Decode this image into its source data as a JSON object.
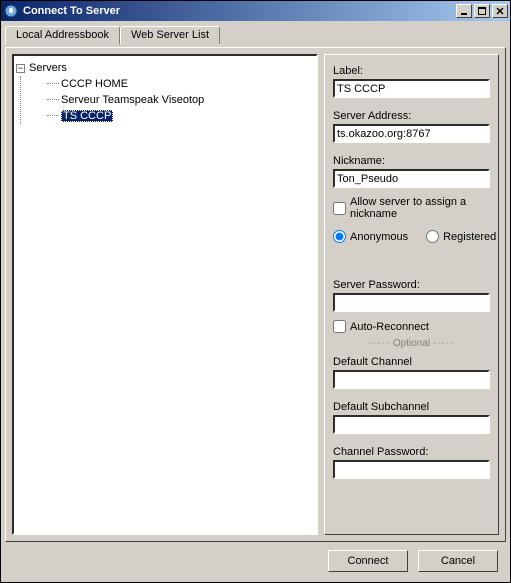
{
  "window": {
    "title": "Connect To Server"
  },
  "tabs": {
    "local": "Local Addressbook",
    "web": "Web Server List"
  },
  "tree": {
    "root": "Servers",
    "items": [
      "CCCP HOME",
      "Serveur Teamspeak Viseotop",
      "TS CCCP"
    ],
    "selected_index": 2
  },
  "form": {
    "label_label": "Label:",
    "label_value": "TS CCCP",
    "addr_label": "Server Address:",
    "addr_value": "ts.okazoo.org:8767",
    "nick_label": "Nickname:",
    "nick_value": "Ton_Pseudo",
    "allow_assign": "Allow server to assign a nickname",
    "anon": "Anonymous",
    "reg": "Registered",
    "server_pw_label": "Server Password:",
    "server_pw_value": "",
    "auto_reconnect": "Auto-Reconnect",
    "optional": " Optional ",
    "def_channel_label": "Default Channel",
    "def_channel_value": "",
    "def_sub_label": "Default Subchannel",
    "def_sub_value": "",
    "chan_pw_label": "Channel Password:",
    "chan_pw_value": ""
  },
  "buttons": {
    "connect": "Connect",
    "cancel": "Cancel"
  }
}
